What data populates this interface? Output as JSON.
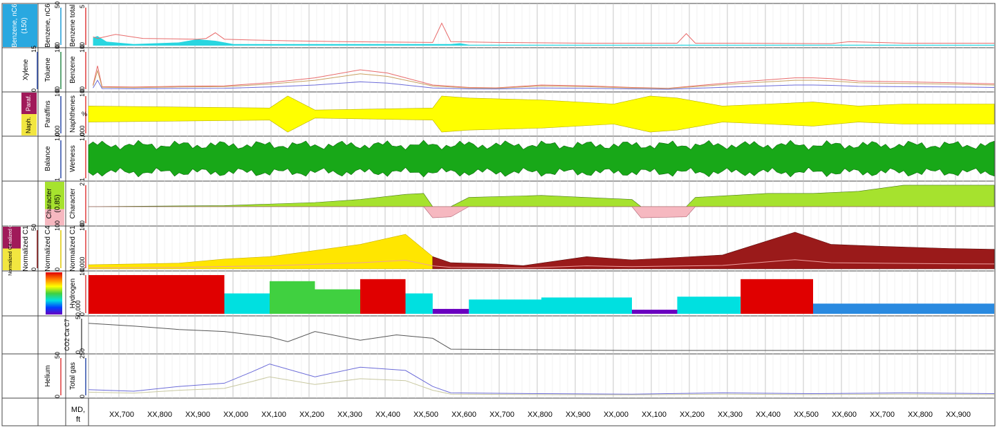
{
  "chart_data": {
    "type": "line",
    "depth_label": "MD, ft",
    "depth_ticks": [
      "XX,700",
      "XX,800",
      "XX,900",
      "XX,000",
      "XX,100",
      "XX,200",
      "XX,300",
      "XX,400",
      "XX,500",
      "XX,600",
      "XX,700",
      "XX,800",
      "XX,900",
      "XX,000",
      "XX,100",
      "XX,200",
      "XX,300",
      "XX,400",
      "XX,500",
      "XX,600",
      "XX,700",
      "XX,800",
      "XX,900"
    ],
    "tracks": [
      {
        "id": "t1",
        "group_label": "Benzene, nC6 (150)",
        "group_color": "#29a8e0",
        "curves": [
          {
            "name": "Benzene, nC6",
            "scale": [
              "0",
              "50"
            ],
            "color": "#1a9ad6"
          },
          {
            "name": "Benzene total",
            "scale": [
              "0",
              "5"
            ],
            "color": "#e03a3a"
          }
        ],
        "y": [
          [
            0.5,
            1.1
          ],
          [
            1.0,
            0.9
          ],
          [
            3.0,
            1.4
          ],
          [
            6.0,
            0.9
          ],
          [
            12.0,
            0.8
          ],
          [
            13.0,
            0.9
          ],
          [
            14.0,
            1.6
          ],
          [
            15.0,
            0.8
          ],
          [
            18.0,
            0.7
          ],
          [
            22.0,
            0.6
          ],
          [
            28.0,
            0.5
          ],
          [
            38.0,
            0.4
          ],
          [
            39.0,
            2.8
          ],
          [
            40.0,
            0.5
          ],
          [
            45.0,
            0.4
          ],
          [
            55.0,
            0.3
          ],
          [
            65.0,
            0.3
          ],
          [
            66.0,
            1.5
          ],
          [
            67.0,
            0.3
          ],
          [
            72.0,
            0.3
          ],
          [
            82.0,
            0.25
          ],
          [
            84.0,
            0.5
          ],
          [
            90.0,
            0.3
          ],
          [
            100.0,
            0.3
          ]
        ]
      },
      {
        "id": "t2",
        "group_label": "",
        "curves": [
          {
            "name": "Xylene",
            "scale": [
              "0",
              "15"
            ],
            "color": "#2a4aa8"
          },
          {
            "name": "Toluene",
            "scale": [
              "0",
              "100"
            ],
            "color": "#2a8a4a"
          },
          {
            "name": "Benzene",
            "scale": [
              "0",
              "100"
            ],
            "color": "#e03a3a"
          }
        ],
        "y": [
          [
            0.5,
            12
          ],
          [
            1.0,
            60
          ],
          [
            1.5,
            8
          ],
          [
            5,
            7
          ],
          [
            10,
            9
          ],
          [
            15,
            10
          ],
          [
            20,
            18
          ],
          [
            25,
            30
          ],
          [
            30,
            50
          ],
          [
            33,
            42
          ],
          [
            38,
            12
          ],
          [
            42,
            6
          ],
          [
            45,
            5
          ],
          [
            50,
            12
          ],
          [
            55,
            10
          ],
          [
            60,
            6
          ],
          [
            64,
            4
          ],
          [
            68,
            12
          ],
          [
            72,
            20
          ],
          [
            75,
            25
          ],
          [
            78,
            30
          ],
          [
            80,
            30
          ],
          [
            82,
            28
          ],
          [
            85,
            22
          ],
          [
            90,
            20
          ],
          [
            95,
            18
          ],
          [
            100,
            15
          ]
        ]
      },
      {
        "id": "t3",
        "group_label": "Paraffins / Naphthenes",
        "labels": [
          "Naph.",
          "Paraf."
        ],
        "label_colors": [
          "#f2e640",
          "#a01a5a"
        ],
        "curves": [
          {
            "name": "Paraffins",
            "scale": [
              "0",
              "100"
            ],
            "color": "#2a4aa8"
          },
          {
            "name": "Naphthenes",
            "scale": [
              "0",
              "100"
            ],
            "unit": "%",
            "color": "#e03a3a"
          }
        ],
        "y": [
          [
            0,
            8
          ],
          [
            20,
            6
          ],
          [
            22,
            18
          ],
          [
            25,
            4
          ],
          [
            38,
            6
          ],
          [
            39,
            18
          ],
          [
            42,
            16
          ],
          [
            50,
            14
          ],
          [
            58,
            10
          ],
          [
            62,
            18
          ],
          [
            65,
            16
          ],
          [
            70,
            8
          ],
          [
            75,
            10
          ],
          [
            80,
            12
          ],
          [
            85,
            8
          ],
          [
            90,
            10
          ],
          [
            95,
            10
          ],
          [
            100,
            10
          ]
        ]
      },
      {
        "id": "t4",
        "group_label": "",
        "curves": [
          {
            "name": "Balance",
            "scale": [
              "1",
              "1,000"
            ],
            "color": "#2a4aa8"
          },
          {
            "name": "Wetness",
            "scale": [
              "1",
              "1,000"
            ],
            "color": "#e03a3a"
          }
        ],
        "y": [
          [
            0,
            520
          ],
          [
            20,
            480
          ],
          [
            40,
            560
          ],
          [
            60,
            540
          ],
          [
            80,
            600
          ],
          [
            100,
            560
          ]
        ]
      },
      {
        "id": "t5",
        "group_label": "Character (0.85)",
        "group_color": "#a6e22e",
        "curves": [
          {
            "name": "Character",
            "scale": [
              "0",
              "2"
            ],
            "color": "#6aa82a"
          }
        ],
        "y": [
          [
            0,
            0.85
          ],
          [
            15,
            0.9
          ],
          [
            25,
            1.05
          ],
          [
            30,
            1.2
          ],
          [
            35,
            1.45
          ],
          [
            37,
            1.5
          ],
          [
            38,
            0.3
          ],
          [
            40,
            0.35
          ],
          [
            42,
            1.3
          ],
          [
            50,
            1.4
          ],
          [
            60,
            1.2
          ],
          [
            61,
            0.3
          ],
          [
            66,
            0.35
          ],
          [
            67,
            1.3
          ],
          [
            75,
            1.5
          ],
          [
            80,
            1.5
          ],
          [
            85,
            1.6
          ],
          [
            90,
            1.9
          ],
          [
            100,
            1.9
          ]
        ]
      },
      {
        "id": "t6",
        "group_label": "Normalized C1",
        "group_color": "#a01a5a",
        "labels": [
          "Normalized C1",
          "Normalized C4"
        ],
        "curves": [
          {
            "name": "Normalized C1",
            "scale": [
              "0",
              "50"
            ],
            "color": "#8a1a1a"
          },
          {
            "name": "Normalized C4",
            "scale": [
              "0",
              "100"
            ],
            "color": "#e0c800"
          }
        ],
        "y": [
          [
            0,
            10
          ],
          [
            10,
            14
          ],
          [
            15,
            24
          ],
          [
            20,
            30
          ],
          [
            25,
            45
          ],
          [
            30,
            60
          ],
          [
            35,
            85
          ],
          [
            38,
            30
          ],
          [
            40,
            15
          ],
          [
            45,
            12
          ],
          [
            48,
            8
          ],
          [
            55,
            30
          ],
          [
            60,
            22
          ],
          [
            65,
            28
          ],
          [
            70,
            34
          ],
          [
            78,
            90
          ],
          [
            82,
            60
          ],
          [
            88,
            55
          ],
          [
            95,
            50
          ],
          [
            100,
            48
          ]
        ]
      },
      {
        "id": "t7",
        "group_label": "Hydrogen",
        "curves": [
          {
            "name": "Hydrogen",
            "scale": [
              "0",
              "10,000"
            ],
            "color": "#e00000"
          }
        ],
        "y": [
          [
            0,
            9500
          ],
          [
            10,
            9500
          ],
          [
            15,
            5000
          ],
          [
            20,
            8000
          ],
          [
            25,
            6000
          ],
          [
            30,
            8500
          ],
          [
            35,
            5000
          ],
          [
            38,
            1200
          ],
          [
            42,
            3500
          ],
          [
            50,
            4000
          ],
          [
            60,
            1000
          ],
          [
            65,
            4200
          ],
          [
            72,
            8500
          ],
          [
            80,
            2500
          ],
          [
            90,
            2500
          ],
          [
            100,
            2400
          ]
        ]
      },
      {
        "id": "t8",
        "group_label": "",
        "curves": [
          {
            "name": "CO2 Ca C7",
            "scale": [
              "0",
              "50,000"
            ],
            "color": "#555555"
          }
        ],
        "y": [
          [
            0,
            42000
          ],
          [
            5,
            38000
          ],
          [
            10,
            33000
          ],
          [
            15,
            30000
          ],
          [
            20,
            22000
          ],
          [
            22,
            15000
          ],
          [
            25,
            30000
          ],
          [
            30,
            17000
          ],
          [
            34,
            25000
          ],
          [
            38,
            20000
          ],
          [
            40,
            4000
          ],
          [
            50,
            3000
          ],
          [
            60,
            2000
          ],
          [
            100,
            2000
          ]
        ]
      },
      {
        "id": "t9",
        "group_label": "",
        "curves": [
          {
            "name": "Helium",
            "scale": [
              "0",
              "50"
            ],
            "color": "#8a8aea"
          },
          {
            "name": "Total gas",
            "scale": [
              "0",
              "250"
            ],
            "color": "#2a4aa8"
          }
        ],
        "y": [
          [
            0,
            40
          ],
          [
            5,
            30
          ],
          [
            10,
            60
          ],
          [
            15,
            80
          ],
          [
            18,
            150
          ],
          [
            20,
            200
          ],
          [
            25,
            120
          ],
          [
            30,
            180
          ],
          [
            35,
            160
          ],
          [
            38,
            60
          ],
          [
            40,
            20
          ],
          [
            50,
            15
          ],
          [
            60,
            12
          ],
          [
            70,
            20
          ],
          [
            80,
            15
          ],
          [
            90,
            20
          ],
          [
            100,
            15
          ]
        ]
      }
    ]
  }
}
